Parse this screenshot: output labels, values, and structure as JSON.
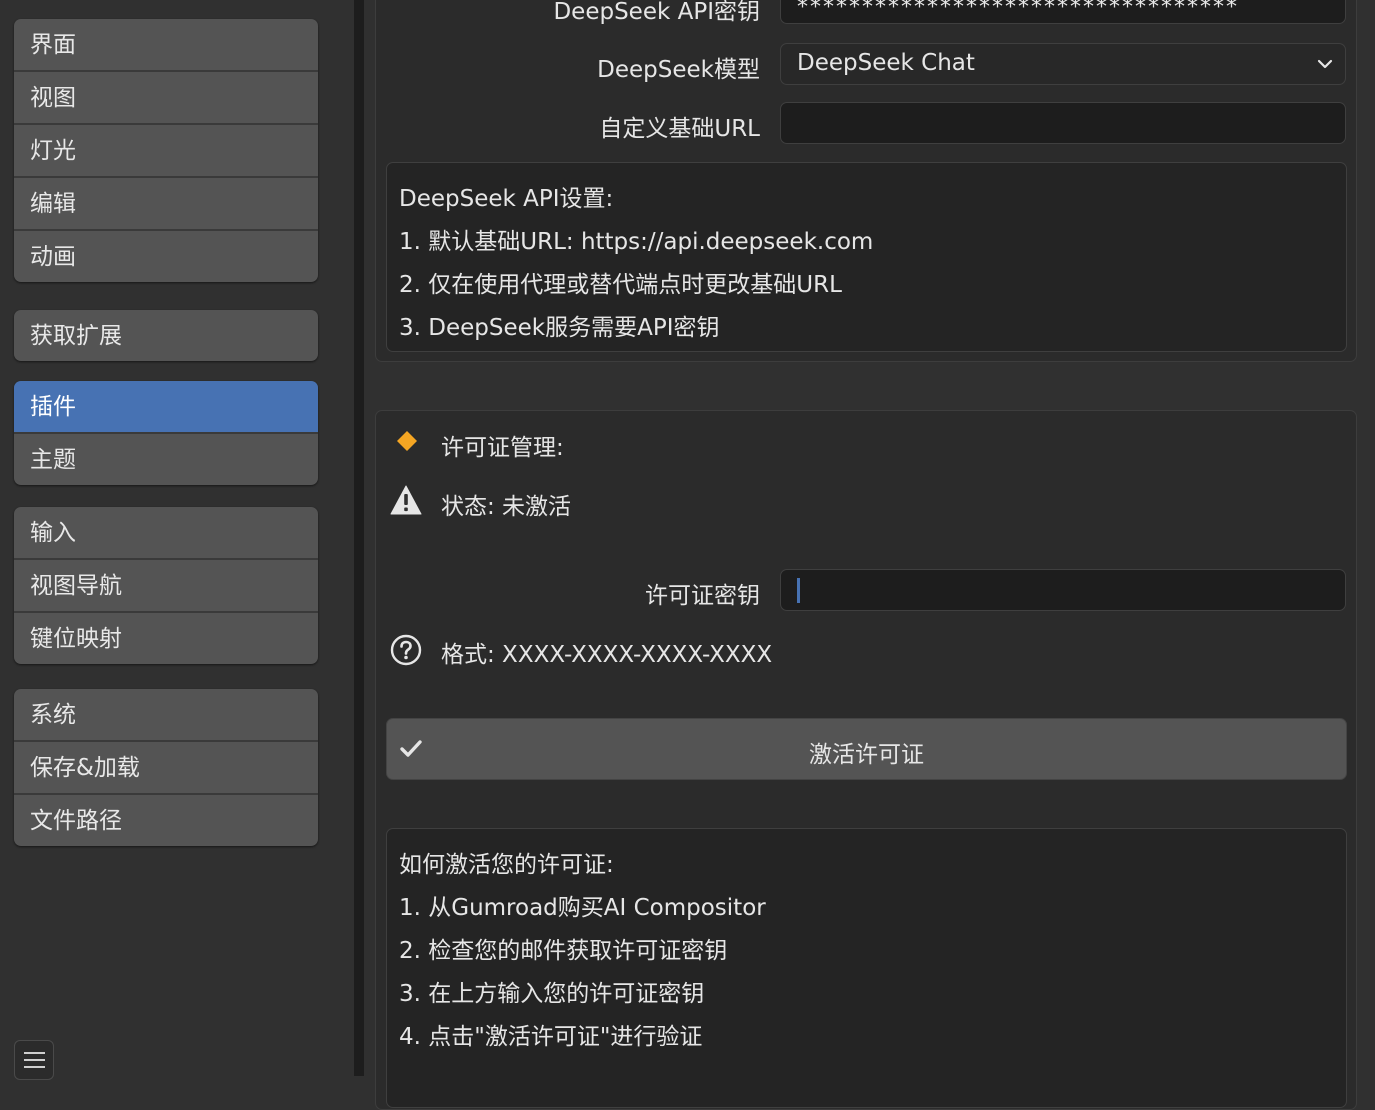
{
  "sidebar": {
    "groups": [
      {
        "items": [
          "界面",
          "视图",
          "灯光",
          "编辑",
          "动画"
        ]
      },
      {
        "items": [
          "获取扩展"
        ]
      },
      {
        "items": [
          "插件",
          "主题"
        ]
      },
      {
        "items": [
          "输入",
          "视图导航",
          "键位映射"
        ]
      },
      {
        "items": [
          "系统",
          "保存&加载",
          "文件路径"
        ]
      }
    ],
    "active_item": "插件"
  },
  "api_settings": {
    "api_key_label": "DeepSeek API密钥",
    "api_key_value": "**********************************",
    "model_label": "DeepSeek模型",
    "model_selected": "DeepSeek Chat",
    "base_url_label": "自定义基础URL",
    "base_url_value": "",
    "info": {
      "title": "DeepSeek API设置:",
      "lines": [
        "1. 默认基础URL: https://api.deepseek.com",
        "2. 仅在使用代理或替代端点时更改基础URL",
        "3. DeepSeek服务需要API密钥"
      ]
    }
  },
  "license": {
    "header": "许可证管理:",
    "status": "状态: 未激活",
    "key_label": "许可证密钥",
    "key_value": "",
    "format_hint": "格式: XXXX-XXXX-XXXX-XXXX",
    "activate_button": "激活许可证",
    "howto": {
      "title": "如何激活您的许可证:",
      "lines": [
        "1. 从Gumroad购买AI Compositor",
        "2. 检查您的邮件获取许可证密钥",
        "3. 在上方输入您的许可证密钥",
        "4. 点击\"激活许可证\"进行验证"
      ]
    }
  },
  "colors": {
    "accent": "#4772b3",
    "warning_diamond": "#f5a623",
    "background": "#303030",
    "field": "#1d1d1d"
  },
  "icons": [
    "menu-icon",
    "dropdown-chevron-icon",
    "diamond-icon",
    "warning-icon",
    "question-icon",
    "checkmark-icon"
  ]
}
